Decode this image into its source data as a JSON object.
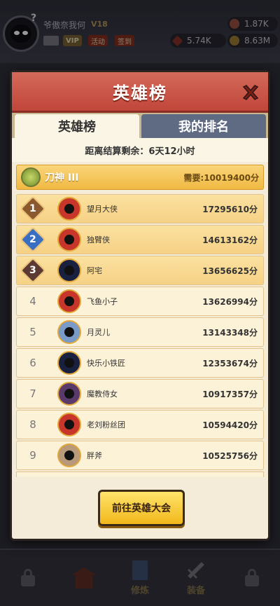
{
  "hud": {
    "player_name": "爷傲奈我何",
    "vip_level": "V18",
    "chip_vip": "VIP",
    "chip_activity": "活动",
    "chip_signin": "签到",
    "res_gem": "1.87K",
    "res_diamond": "5.74K",
    "res_gold": "8.63M",
    "plus": "+"
  },
  "bottom_nav": [
    {
      "label": "",
      "icon": "lock-icon"
    },
    {
      "label": "",
      "icon": "temple-icon"
    },
    {
      "label": "修炼",
      "icon": "book-icon"
    },
    {
      "label": "装备",
      "icon": "sword-icon"
    },
    {
      "label": "",
      "icon": "lock-icon"
    }
  ],
  "panel": {
    "title": "英雄榜",
    "tab_hero_list": "英雄榜",
    "tab_my_rank": "我的排名",
    "countdown": "距离结算剩余：6天12小时",
    "tier_name": "刀神 III",
    "tier_requirement": "需要:10019400分",
    "action_button": "前往英雄大会"
  },
  "rankings": [
    {
      "rank": "1",
      "name": "望月大侠",
      "score": "17295610分"
    },
    {
      "rank": "2",
      "name": "独臂侠",
      "score": "14613162分"
    },
    {
      "rank": "3",
      "name": "阿宅",
      "score": "13656625分"
    },
    {
      "rank": "4",
      "name": "飞鱼小子",
      "score": "13626994分"
    },
    {
      "rank": "5",
      "name": "月灵儿",
      "score": "13143348分"
    },
    {
      "rank": "6",
      "name": "快乐小铁匠",
      "score": "12353674分"
    },
    {
      "rank": "7",
      "name": "魔教侍女",
      "score": "10917357分"
    },
    {
      "rank": "8",
      "name": "老刘粉丝团",
      "score": "10594420分"
    },
    {
      "rank": "9",
      "name": "胖斧",
      "score": "10525756分"
    }
  ],
  "colors": {
    "title_red": "#c0463a",
    "panel_bg": "#f4ecd8",
    "tier_gold": "#f0b942",
    "inactive_tab": "#5e6b82",
    "button_yellow": "#f2b81c"
  }
}
